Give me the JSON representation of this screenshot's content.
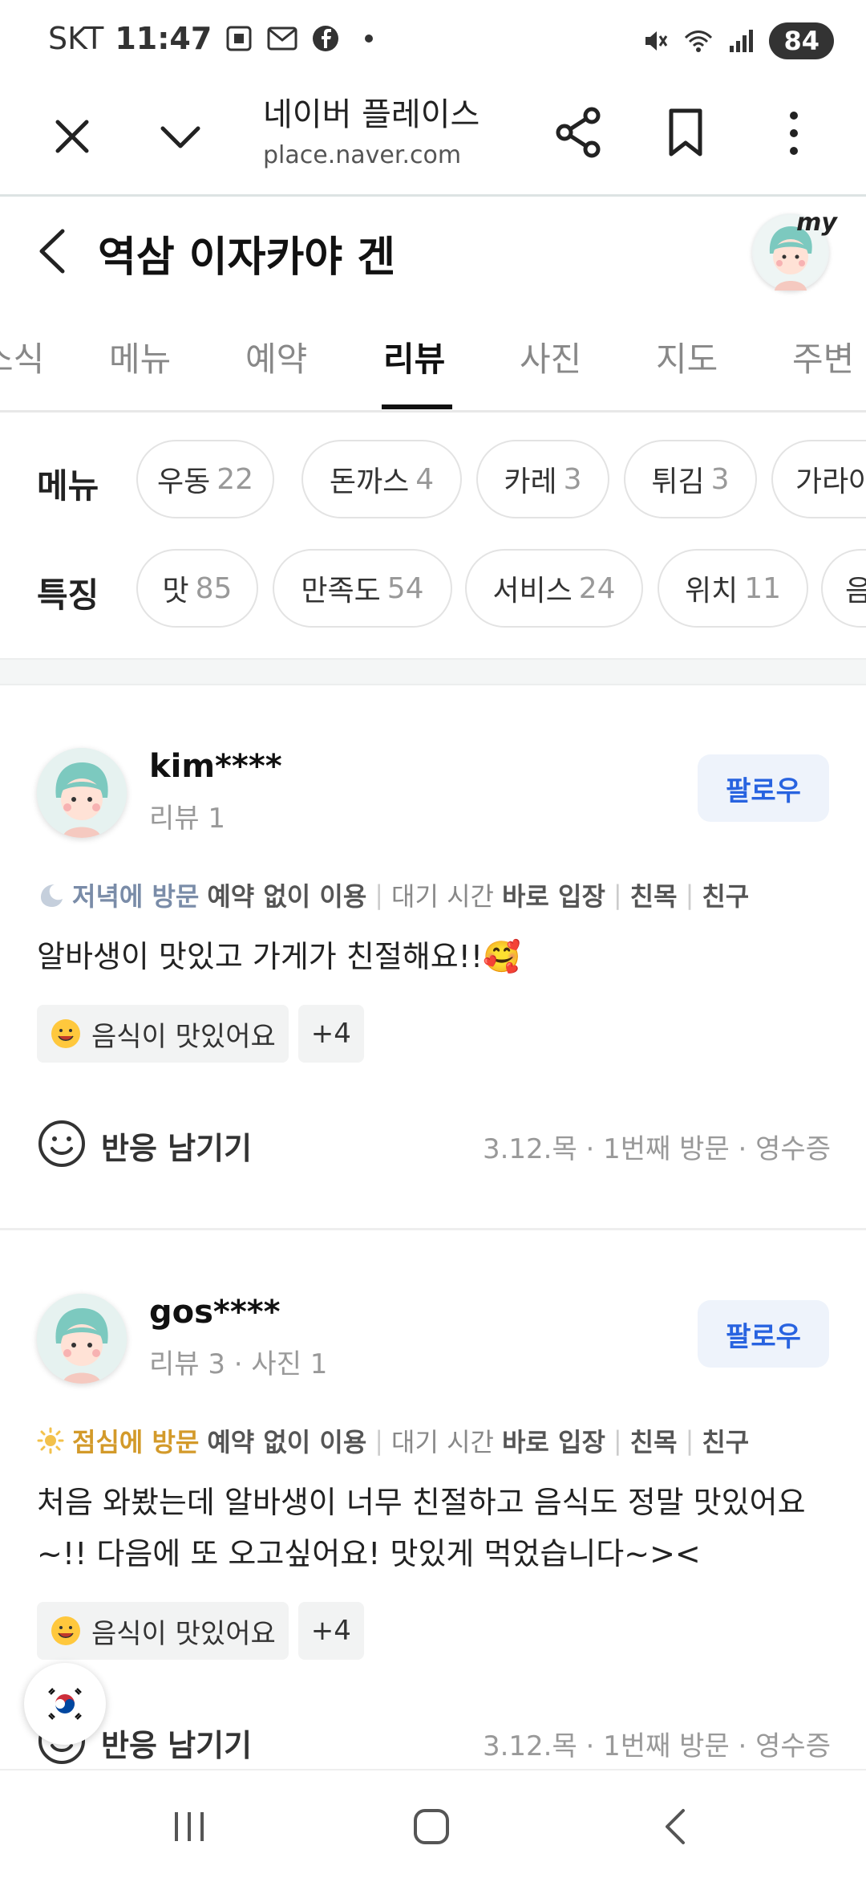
{
  "status_bar": {
    "carrier": "SKT",
    "time": "11:47",
    "battery": "84"
  },
  "browser": {
    "title": "네이버 플레이스",
    "url": "place.naver.com"
  },
  "place": {
    "name": "역삼 이자카야 겐",
    "my_badge": "my"
  },
  "tabs": [
    {
      "label": "소식"
    },
    {
      "label": "메뉴"
    },
    {
      "label": "예약"
    },
    {
      "label": "리뷰",
      "active": true
    },
    {
      "label": "사진"
    },
    {
      "label": "지도"
    },
    {
      "label": "주변"
    }
  ],
  "filters": {
    "menu_label": "메뉴",
    "menu_chips": [
      {
        "name": "우동",
        "count": "22"
      },
      {
        "name": "돈까스",
        "count": "4"
      },
      {
        "name": "카레",
        "count": "3"
      },
      {
        "name": "튀김",
        "count": "3"
      },
      {
        "name": "가라아",
        "count": ""
      }
    ],
    "feature_label": "특징",
    "feature_chips": [
      {
        "name": "맛",
        "count": "85"
      },
      {
        "name": "만족도",
        "count": "54"
      },
      {
        "name": "서비스",
        "count": "24"
      },
      {
        "name": "위치",
        "count": "11"
      },
      {
        "name": "음",
        "count": ""
      }
    ]
  },
  "reviews": [
    {
      "user": "kim****",
      "stats": "리뷰 1",
      "follow": "팔로우",
      "visit_time": "저녁에 방문",
      "reservation": "예약 없이 이용",
      "wait_label": "대기 시간",
      "wait_value": "바로 입장",
      "purpose": "친목",
      "companion": "친구",
      "text": "알바생이 맛있고 가게가 친절해요!!🥰",
      "tag": "음식이 맛있어요",
      "tag_more": "+4",
      "react": "반응 남기기",
      "date": "3.12.목 · 1번째 방문 · 영수증"
    },
    {
      "user": "gos****",
      "stats": "리뷰 3 · 사진 1",
      "follow": "팔로우",
      "visit_time": "점심에 방문",
      "reservation": "예약 없이 이용",
      "wait_label": "대기 시간",
      "wait_value": "바로 입장",
      "purpose": "친목",
      "companion": "친구",
      "text": "처음 와봤는데 알바생이 너무 친절하고 음식도 정말 맛있어요~!! 다음에 또 오고싶어요! 맛있게 먹었습니다~><",
      "tag": "음식이 맛있어요",
      "tag_more": "+4",
      "react": "반응 남기기",
      "date": "3.12.목 · 1번째 방문 · 영수증"
    }
  ],
  "colors": {
    "follow_text": "#2863e0",
    "follow_bg": "#eef3fb",
    "evening": "#7a8ca8",
    "lunch": "#d39a2a"
  }
}
